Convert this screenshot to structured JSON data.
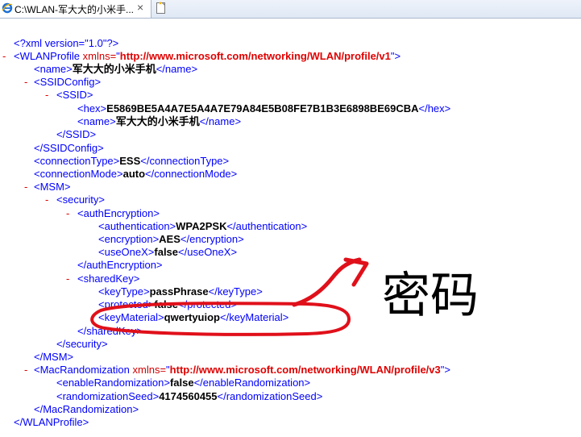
{
  "tab": {
    "title": "C:\\WLAN-军大大的小米手...",
    "close": "×",
    "icon": "ie-icon"
  },
  "xml": {
    "decl": "<?xml version=\"1.0\"?>",
    "wlanprofile_ns": "http://www.microsoft.com/networking/WLAN/profile/v1",
    "name": "军大大的小米手机",
    "hex": "E5869BE5A4A7E5A4A7E79A84E5B08FE7B1B3E6898BE69CBA",
    "ssid_name": "军大大的小米手机",
    "connectionType": "ESS",
    "connectionMode": "auto",
    "authentication": "WPA2PSK",
    "encryption": "AES",
    "useOneX": "false",
    "keyType": "passPhrase",
    "protected": "false",
    "keyMaterial": "qwertyuiop",
    "macrandomization_ns": "http://www.microsoft.com/networking/WLAN/profile/v3",
    "enableRandomization": "false",
    "randomizationSeed": "4174560455"
  },
  "annotation": {
    "text": "密码",
    "color": "#e0101a"
  },
  "markers": {
    "collapse": "-"
  }
}
